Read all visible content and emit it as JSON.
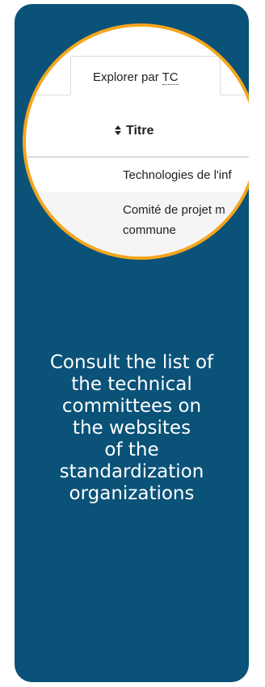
{
  "preview": {
    "tab_label_prefix": "Explorer par ",
    "tab_label_abbr": "TC",
    "table": {
      "column_header": "Titre",
      "rows": [
        "Technologies de l'inf",
        "Comité de projet m",
        "commune"
      ]
    }
  },
  "message": "Consult the list of\nthe technical\ncommittees on\nthe websites\nof the\nstandardization\norganizations",
  "colors": {
    "card_background": "#0a5278",
    "lens_border": "#f5a51c",
    "text_light": "#ffffff"
  }
}
